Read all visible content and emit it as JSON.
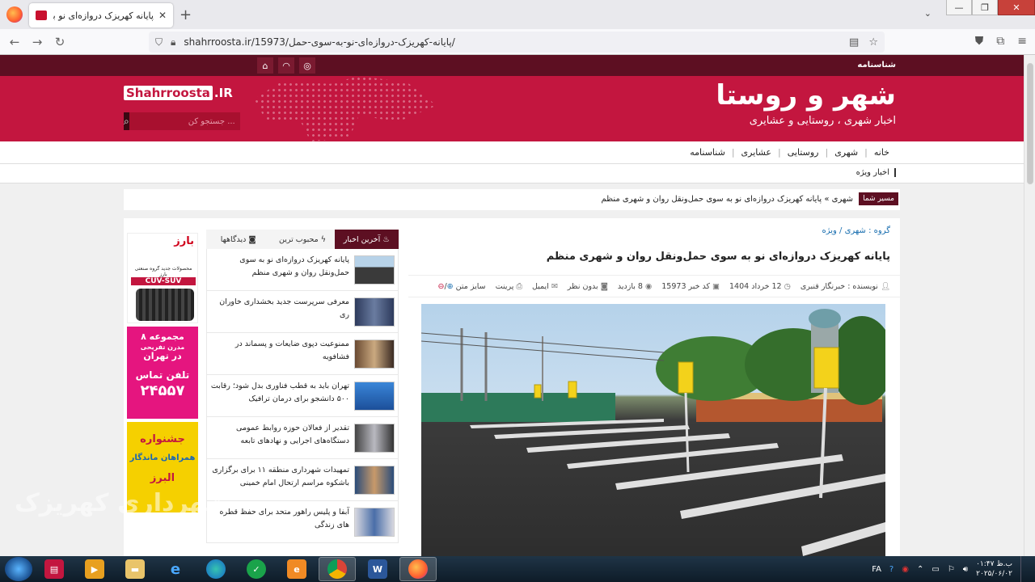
{
  "browser": {
    "tab_title": "پایانه کهریزک دروازه‌ای نو به سوی",
    "tab_close": "✕",
    "new_tab": "+",
    "url": "shahrroosta.ir/15973/پایانه-کهریزک-دروازه‌ای-نو-به-سوی-حمل/",
    "window_controls": [
      "—",
      "❐",
      "✕"
    ]
  },
  "site": {
    "top_link": "شناسنامه",
    "logo_title": "شهر و روستا",
    "logo_subtitle": "اخبار شهری ، روستایی و عشایری",
    "brand_a": "Shahrroosta",
    "brand_b": ".IR",
    "search_placeholder": "جستجو کن ...",
    "menu": [
      "خانه",
      "شهری",
      "روستایی",
      "عشایری",
      "شناسنامه"
    ],
    "special_news": "اخبار ویژه",
    "breadcrumb_label": "مسیر شما",
    "breadcrumb_text": "شهری » پایانه کهریزک دروازه‌ای نو به سوی حمل‌ونقل روان و شهری منظم"
  },
  "article": {
    "group": "گروه : شهری / ویژه",
    "title": "پایانه کهریزک دروازه‌ای نو به سوی حمل‌ونقل روان و شهری منظم",
    "meta": {
      "author": "نویسنده : خبرنگار قنبری",
      "date": "12 خرداد 1404",
      "news_code": "کد خبر 15973",
      "views": "8 بازدید",
      "comments": "بدون نظر",
      "email": "ایمیل",
      "print": "پرینت",
      "font_size": "سایز متن"
    }
  },
  "news_panel": {
    "tabs": [
      "آخرین اخبار",
      "محبوب ترین",
      "دیدگاهها"
    ],
    "items": [
      "پایانه کهریزک دروازه‌ای نو به سوی حمل‌ونقل روان و شهری منظم",
      "معرفی سرپرست جدید بخشداری خاوران ری",
      "ممنوعیت دپوی ضایعات و پسماند در فشافویه",
      "تهران باید به قطب فناوری بدل شود؛ رقابت ۵۰۰ دانشجو برای درمان ترافیک",
      "تقدیر از فعالان حوزه روابط عمومی دستگاه‌های اجرایی و نهادهای تابعه",
      "تمهیدات شهرداری منطقه ۱۱ برای برگزاری باشکوه مراسم ارتحال امام خمینی",
      "آبفا و پلیس راهور متحد برای حفظ قطره های زندگی"
    ]
  },
  "ads": {
    "ad1_brand": "بارز",
    "ad1_sub": "محصولات جدید گروه صنعتی بارز",
    "ad1_cuv": "CUV-SUV",
    "ad2_l1": "۸ مجموعه",
    "ad2_l2": "مدرن تفریحی",
    "ad2_l3": "در تهران",
    "ad2_l4": "تلفن تماس",
    "ad2_phone": "۲۴۵۵۷",
    "ad3_l1": "جشنواره",
    "ad3_l2": "همراهان ماندگار",
    "ad3_l3": "البرز"
  },
  "watermark": "شهرداری کهریزک",
  "taskbar": {
    "lang": "FA",
    "time": "ب.ظ ۰۱:۴۷",
    "date": "۲۰۲۵/۰۶/۰۲"
  }
}
